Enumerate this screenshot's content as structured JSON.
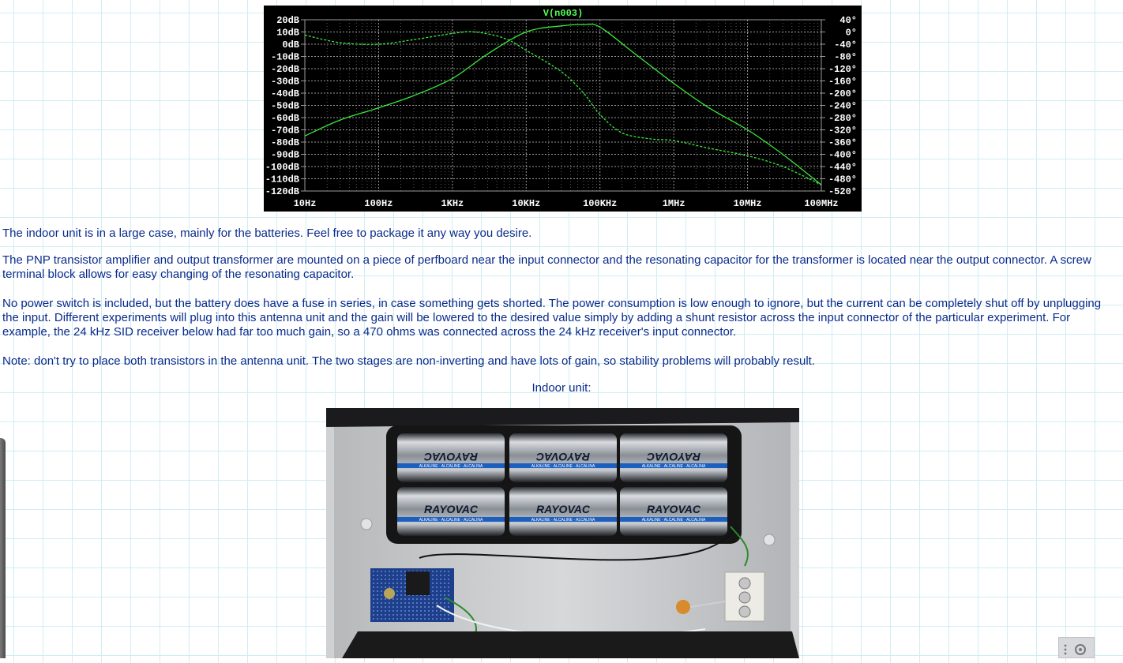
{
  "chart_data": {
    "type": "line",
    "title": "V(n003)",
    "x_scale": "log",
    "x_ticks": [
      "10Hz",
      "100Hz",
      "1KHz",
      "10KHz",
      "100KHz",
      "1MHz",
      "10MHz",
      "100MHz"
    ],
    "y_left_ticks": [
      "20dB",
      "10dB",
      "0dB",
      "-10dB",
      "-20dB",
      "-30dB",
      "-40dB",
      "-50dB",
      "-60dB",
      "-70dB",
      "-80dB",
      "-90dB",
      "-100dB",
      "-110dB",
      "-120dB"
    ],
    "y_right_ticks": [
      "40°",
      "0°",
      "-40°",
      "-80°",
      "-120°",
      "-160°",
      "-200°",
      "-240°",
      "-280°",
      "-320°",
      "-360°",
      "-400°",
      "-440°",
      "-480°",
      "-520°"
    ],
    "ylim_left": [
      -120,
      20
    ],
    "ylim_right": [
      -520,
      40
    ],
    "xlim_hz": [
      10,
      100000000
    ],
    "grid": true,
    "series": [
      {
        "style": "solid",
        "axis": "left",
        "x": [
          10,
          30,
          100,
          300,
          1000,
          3000,
          10000,
          30000,
          60000,
          100000,
          300000,
          1000000,
          3000000,
          10000000,
          30000000,
          100000000
        ],
        "y": [
          -75,
          -62,
          -52,
          -42,
          -28,
          -8,
          10,
          15,
          16,
          14,
          -8,
          -32,
          -52,
          -70,
          -90,
          -115
        ]
      },
      {
        "style": "dashed",
        "axis": "right",
        "x": [
          10,
          30,
          100,
          300,
          1000,
          2000,
          5000,
          10000,
          30000,
          60000,
          100000,
          200000,
          500000,
          1000000,
          3000000,
          10000000,
          30000000,
          100000000
        ],
        "y": [
          -10,
          -35,
          -40,
          -25,
          -5,
          0,
          -20,
          -60,
          -130,
          -200,
          -270,
          -330,
          -350,
          -355,
          -380,
          -405,
          -440,
          -500
        ]
      }
    ]
  },
  "colors": {
    "chart_bg": "#000000",
    "chart_trace": "#3ae83a",
    "chart_grid": "#9a9a9a",
    "chart_text": "#ffffff",
    "title_text": "#55ff55",
    "body_text": "#0a2a8c"
  },
  "content": {
    "p1": "The indoor unit is in a large case, mainly for the batteries. Feel free to package it any way you desire.",
    "p2": "The PNP transistor amplifier and output transformer are mounted on a piece of perfboard near the input connector and the resonating capacitor for the transformer is located near the output connector. A screw terminal block allows for easy changing of the resonating capacitor.",
    "p3": "No power switch is included, but the battery does have a fuse in series, in case something gets shorted. The power consumption is low enough to ignore, but the current can be completely shut off by unplugging the input. Different experiments will plug into this antenna unit and the gain will be lowered to the desired value simply by adding a shunt resistor across the input connector of the particular experiment. For example, the 24 kHz SID receiver below had far too much gain, so a 470 ohms was connected across the 24 kHz receiver's input connector.",
    "p4": "Note: don't try to place both transistors in the antenna unit. The two stages are non-inverting and have lots of gain, so stability problems will probably result.",
    "caption": "Indoor unit:"
  },
  "photo": {
    "battery_brand": "RAYOVAC",
    "battery_band": "ALKALINE · ALCALINE · ALCALINA"
  }
}
